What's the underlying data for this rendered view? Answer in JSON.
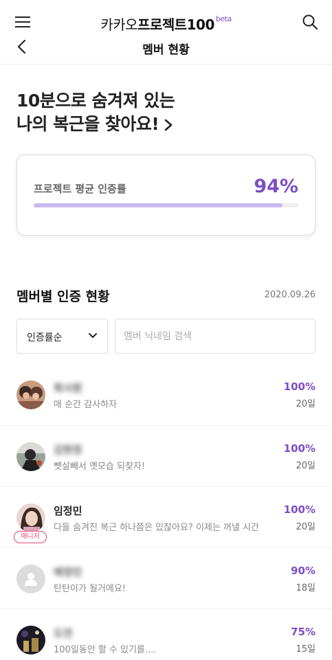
{
  "header": {
    "brand_prefix": "카카오",
    "brand_main": "프로젝트100",
    "brand_badge": "beta",
    "title": "멤버 현황"
  },
  "hero": {
    "line1": "10분으로 숨겨져 있는",
    "line2": "나의 복근을 찾아요!"
  },
  "average": {
    "label": "프로젝트 평균 인증률",
    "value_text": "94%",
    "progress_percent": 94
  },
  "section": {
    "title": "멤버별 인증 현황",
    "date": "2020.09.26"
  },
  "filters": {
    "sort_selected": "인증률순",
    "search_placeholder": "멤버 닉네임 검색"
  },
  "colors": {
    "accent": "#7b4fc4",
    "progress_fill": "#c8b8f0",
    "manager_badge": "#e04a6e"
  },
  "members": [
    {
      "name": "",
      "name_blurred": true,
      "message": "매 순간 감사하자",
      "rate": "100%",
      "days": "20일",
      "badge": "",
      "avatar": "photo"
    },
    {
      "name": "",
      "name_blurred": true,
      "message": "뺏살빼서 옛모습 되찾자!",
      "rate": "100%",
      "days": "20일",
      "badge": "",
      "avatar": "photo"
    },
    {
      "name": "임정민",
      "name_blurred": false,
      "message": "다들 숨겨진 복근 하나쯤은 있잖아요? 이제는 꺼낼 시간",
      "rate": "100%",
      "days": "20일",
      "badge": "매니저",
      "avatar": "photo"
    },
    {
      "name": "",
      "name_blurred": true,
      "message": "탄탄이가 될거에요!",
      "rate": "90%",
      "days": "18일",
      "badge": "",
      "avatar": "default"
    },
    {
      "name": "",
      "name_blurred": true,
      "message": "100일동안 할 수 있기를....",
      "rate": "75%",
      "days": "15일",
      "badge": "",
      "avatar": "photo"
    }
  ]
}
